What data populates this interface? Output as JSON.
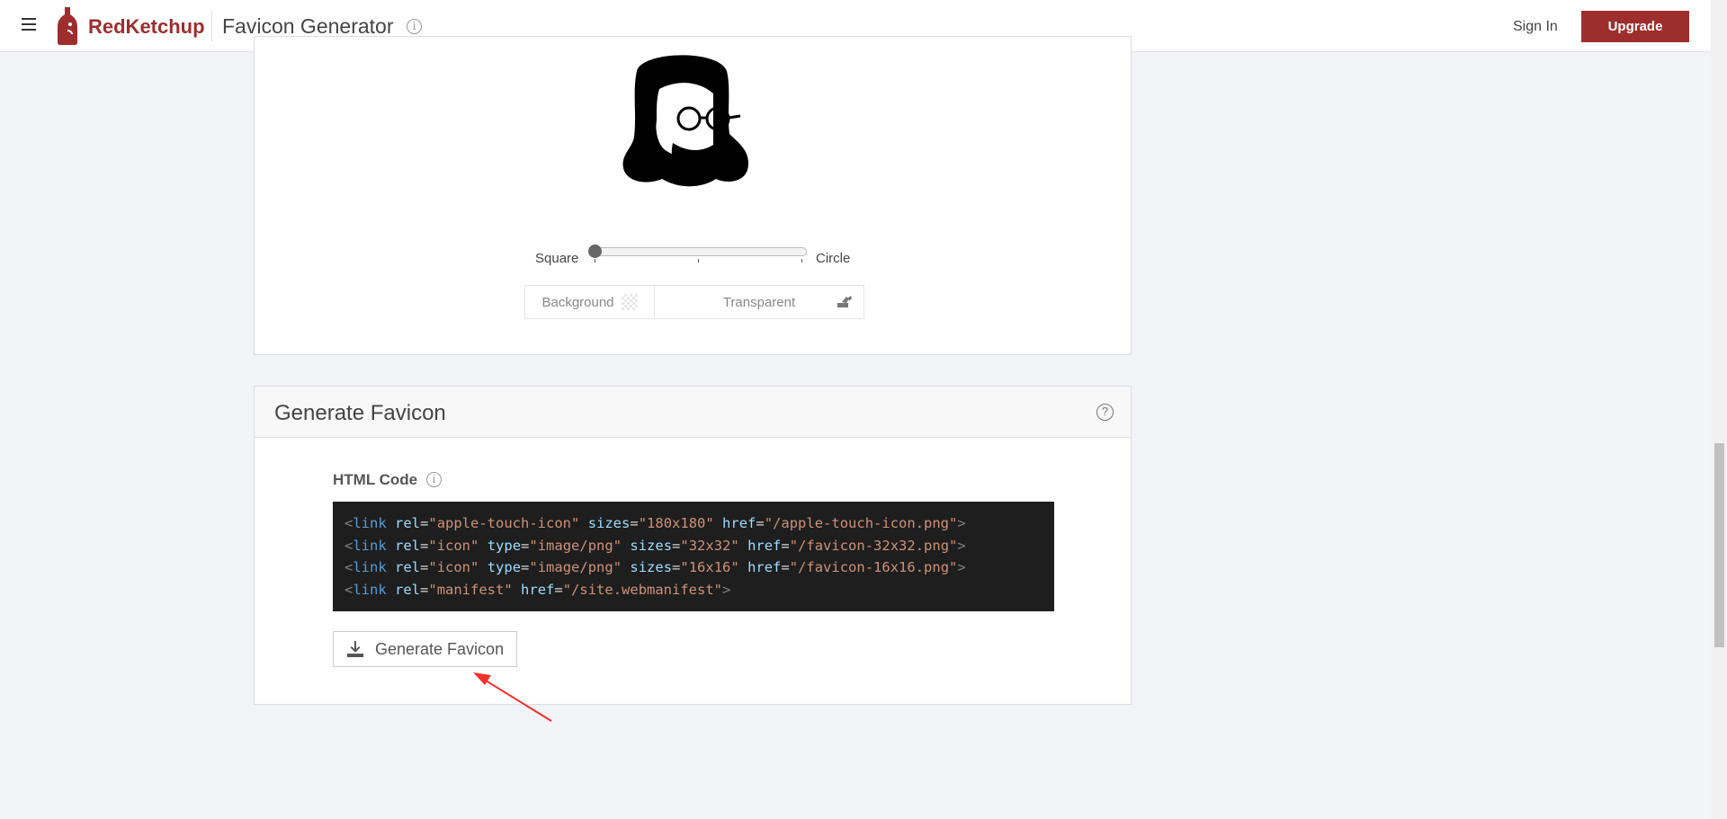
{
  "header": {
    "brand": "RedKetchup",
    "title": "Favicon Generator",
    "sign_in": "Sign In",
    "upgrade": "Upgrade"
  },
  "shape": {
    "left_label": "Square",
    "right_label": "Circle",
    "value": 0
  },
  "background": {
    "label": "Background",
    "value": "Transparent"
  },
  "generate": {
    "title": "Generate Favicon",
    "html_code_label": "HTML Code",
    "code_lines": [
      [
        [
          "p",
          "<"
        ],
        [
          "t",
          "link"
        ],
        [
          "e",
          " "
        ],
        [
          "a",
          "rel"
        ],
        [
          "e",
          "="
        ],
        [
          "s",
          "\"apple-touch-icon\""
        ],
        [
          "e",
          " "
        ],
        [
          "a",
          "sizes"
        ],
        [
          "e",
          "="
        ],
        [
          "s",
          "\"180x180\""
        ],
        [
          "e",
          " "
        ],
        [
          "a",
          "href"
        ],
        [
          "e",
          "="
        ],
        [
          "s",
          "\"/apple-touch-icon.png\""
        ],
        [
          "p",
          ">"
        ]
      ],
      [
        [
          "p",
          "<"
        ],
        [
          "t",
          "link"
        ],
        [
          "e",
          " "
        ],
        [
          "a",
          "rel"
        ],
        [
          "e",
          "="
        ],
        [
          "s",
          "\"icon\""
        ],
        [
          "e",
          " "
        ],
        [
          "a",
          "type"
        ],
        [
          "e",
          "="
        ],
        [
          "s",
          "\"image/png\""
        ],
        [
          "e",
          " "
        ],
        [
          "a",
          "sizes"
        ],
        [
          "e",
          "="
        ],
        [
          "s",
          "\"32x32\""
        ],
        [
          "e",
          " "
        ],
        [
          "a",
          "href"
        ],
        [
          "e",
          "="
        ],
        [
          "s",
          "\"/favicon-32x32.png\""
        ],
        [
          "p",
          ">"
        ]
      ],
      [
        [
          "p",
          "<"
        ],
        [
          "t",
          "link"
        ],
        [
          "e",
          " "
        ],
        [
          "a",
          "rel"
        ],
        [
          "e",
          "="
        ],
        [
          "s",
          "\"icon\""
        ],
        [
          "e",
          " "
        ],
        [
          "a",
          "type"
        ],
        [
          "e",
          "="
        ],
        [
          "s",
          "\"image/png\""
        ],
        [
          "e",
          " "
        ],
        [
          "a",
          "sizes"
        ],
        [
          "e",
          "="
        ],
        [
          "s",
          "\"16x16\""
        ],
        [
          "e",
          " "
        ],
        [
          "a",
          "href"
        ],
        [
          "e",
          "="
        ],
        [
          "s",
          "\"/favicon-16x16.png\""
        ],
        [
          "p",
          ">"
        ]
      ],
      [
        [
          "p",
          "<"
        ],
        [
          "t",
          "link"
        ],
        [
          "e",
          " "
        ],
        [
          "a",
          "rel"
        ],
        [
          "e",
          "="
        ],
        [
          "s",
          "\"manifest\""
        ],
        [
          "e",
          " "
        ],
        [
          "a",
          "href"
        ],
        [
          "e",
          "="
        ],
        [
          "s",
          "\"/site.webmanifest\""
        ],
        [
          "p",
          ">"
        ]
      ]
    ],
    "button": "Generate Favicon"
  },
  "colors": {
    "brand": "#9e2e2e",
    "annotation_arrow": "#f0322d"
  }
}
